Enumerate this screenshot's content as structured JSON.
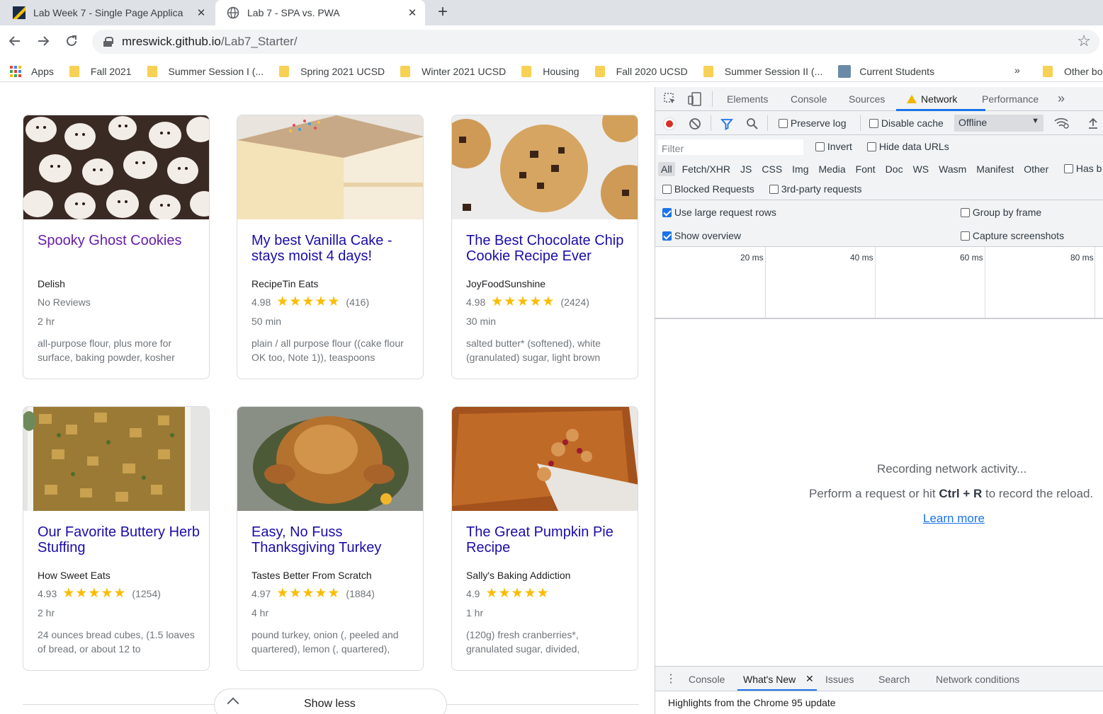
{
  "browser": {
    "tabs": [
      {
        "title": "Lab Week 7 - Single Page Applica",
        "active": false
      },
      {
        "title": "Lab 7 - SPA vs. PWA",
        "active": true
      }
    ],
    "new_tab": "+",
    "address": {
      "host": "mreswick.github.io",
      "path": "/Lab7_Starter/"
    },
    "bookmarks": [
      {
        "label": "Apps",
        "icon": "apps-grid-icon"
      },
      {
        "label": "Fall 2021",
        "icon": "folder-icon"
      },
      {
        "label": "Summer Session I (...",
        "icon": "folder-icon"
      },
      {
        "label": "Spring 2021 UCSD",
        "icon": "folder-icon"
      },
      {
        "label": "Winter 2021 UCSD",
        "icon": "folder-icon"
      },
      {
        "label": "Housing",
        "icon": "folder-icon"
      },
      {
        "label": "Fall 2020 UCSD",
        "icon": "folder-icon"
      },
      {
        "label": "Summer Session II (...",
        "icon": "folder-icon"
      },
      {
        "label": "Current Students",
        "icon": "site-icon"
      }
    ],
    "bookmarks_overflow": "»",
    "other_bookmarks": "Other bo"
  },
  "recipes": [
    {
      "title": "Spooky Ghost Cookies",
      "org": "Delish",
      "rating": "No Reviews",
      "stars": "",
      "count": "",
      "time": "2 hr",
      "ingredients": "all-purpose flour, plus more for surface, baking powder, kosher",
      "visited": true
    },
    {
      "title": "My best Vanilla Cake - stays moist 4 days!",
      "org": "RecipeTin Eats",
      "rating": "4.98",
      "stars": "★★★★★",
      "count": "(416)",
      "time": "50 min",
      "ingredients": "plain / all purpose flour ((cake flour OK too, Note 1)), teaspoons",
      "visited": false
    },
    {
      "title": "The Best Chocolate Chip Cookie Recipe Ever",
      "org": "JoyFoodSunshine",
      "rating": "4.98",
      "stars": "★★★★★",
      "count": "(2424)",
      "time": "30 min",
      "ingredients": "salted butter* (softened), white (granulated) sugar, light brown",
      "visited": false
    },
    {
      "title": "Our Favorite Buttery Herb Stuffing",
      "org": "How Sweet Eats",
      "rating": "4.93",
      "stars": "★★★★★",
      "count": "(1254)",
      "time": "2 hr",
      "ingredients": "24 ounces bread cubes, (1.5 loaves of bread, or about 12 to",
      "visited": false
    },
    {
      "title": "Easy, No Fuss Thanksgiving Turkey",
      "org": "Tastes Better From Scratch",
      "rating": "4.97",
      "stars": "★★★★★",
      "count": "(1884)",
      "time": "4 hr",
      "ingredients": "pound turkey, onion (, peeled and quartered), lemon (, quartered),",
      "visited": false
    },
    {
      "title": "The Great Pumpkin Pie Recipe",
      "org": "Sally's Baking Addiction",
      "rating": "4.9",
      "stars": "★★★★★",
      "count": "",
      "time": "1 hr",
      "ingredients": "(120g) fresh cranberries*, granulated sugar, divided,",
      "visited": false
    }
  ],
  "show_less": "Show less",
  "devtools": {
    "tabs": [
      "Elements",
      "Console",
      "Sources",
      "Network",
      "Performance"
    ],
    "more_tabs": "»",
    "active_tab": "Network",
    "preserve_log": "Preserve log",
    "disable_cache": "Disable cache",
    "throttling": "Offline",
    "filter_placeholder": "Filter",
    "invert": "Invert",
    "hide_data_urls": "Hide data URLs",
    "types": [
      "All",
      "Fetch/XHR",
      "JS",
      "CSS",
      "Img",
      "Media",
      "Font",
      "Doc",
      "WS",
      "Wasm",
      "Manifest",
      "Other"
    ],
    "has_blocked": "Has b",
    "blocked_requests": "Blocked Requests",
    "third_party": "3rd-party requests",
    "use_large_rows": "Use large request rows",
    "show_overview": "Show overview",
    "group_by_frame": "Group by frame",
    "capture_screenshots": "Capture screenshots",
    "ticks": [
      "20 ms",
      "40 ms",
      "60 ms",
      "80 ms"
    ],
    "recording": "Recording network activity...",
    "perform_pre": "Perform a request or hit ",
    "shortcut": "Ctrl + R",
    "perform_post": " to record the reload.",
    "learn_more": "Learn more",
    "drawer_tabs": [
      "Console",
      "What's New",
      "Issues",
      "Search",
      "Network conditions"
    ],
    "drawer_active": "What's New",
    "highlights": "Highlights from the Chrome 95 update"
  },
  "colors": {
    "link": "#1a0dab",
    "visited": "#681da8",
    "star": "#fbbc04",
    "accent": "#1a73e8"
  }
}
